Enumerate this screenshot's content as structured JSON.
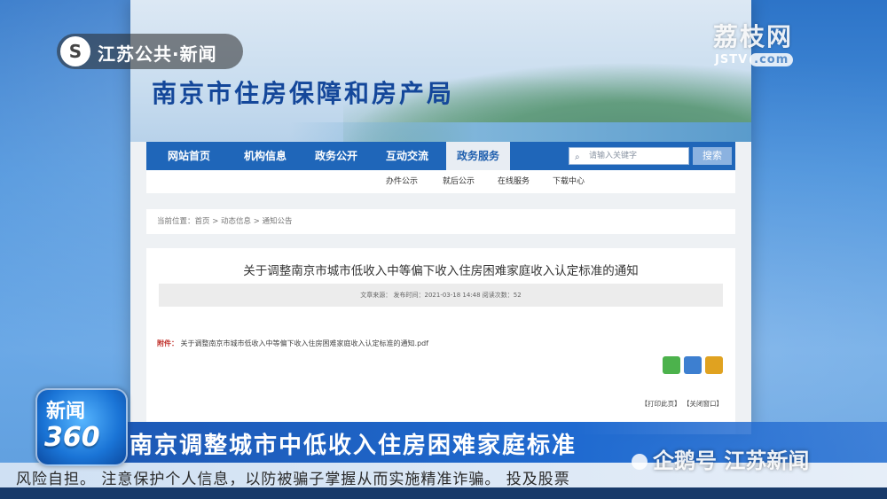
{
  "station": {
    "name": "江苏公共·新闻",
    "logo_char": "S"
  },
  "watermark": {
    "title": "荔枝网",
    "url_main": "JSTV",
    "url_tld": ".com"
  },
  "site": {
    "title": "南京市住房保障和房产局",
    "nav": [
      {
        "label": "网站首页"
      },
      {
        "label": "机构信息"
      },
      {
        "label": "政务公开"
      },
      {
        "label": "互动交流"
      },
      {
        "label": "政务服务",
        "active": true
      }
    ],
    "search": {
      "placeholder": "请输入关键字",
      "button": "搜索"
    },
    "subnav": [
      "办件公示",
      "就后公示",
      "在线服务",
      "下载中心"
    ],
    "breadcrumb": "当前位置：首页 > 动态信息 > 通知公告",
    "article": {
      "title": "关于调整南京市城市低收入中等偏下收入住房困难家庭收入认定标准的通知",
      "meta": "文章来源：      发布时间：2021-03-18 14:48     阅读次数：52",
      "attachment_label": "附件：",
      "attachment_file": "关于调整南京市城市低收入中等偏下收入住房困难家庭收入认定标准的通知.pdf",
      "print_link": "【打印此页】",
      "close_link": "【关闭窗口】"
    },
    "share_colors": {
      "wechat": "#4cb24c",
      "star": "#3d7fd0",
      "weibo": "#e0a220"
    }
  },
  "news": {
    "badge_top": "新闻",
    "badge_bottom": "360",
    "headline": "南京调整城市中低收入住房困难家庭标准",
    "ticker": "风险自担。  注意保护个人信息，以防被骗子掌握从而实施精准诈骗。  投及股票",
    "author_watermark": "企鹅号 江苏新闻"
  }
}
